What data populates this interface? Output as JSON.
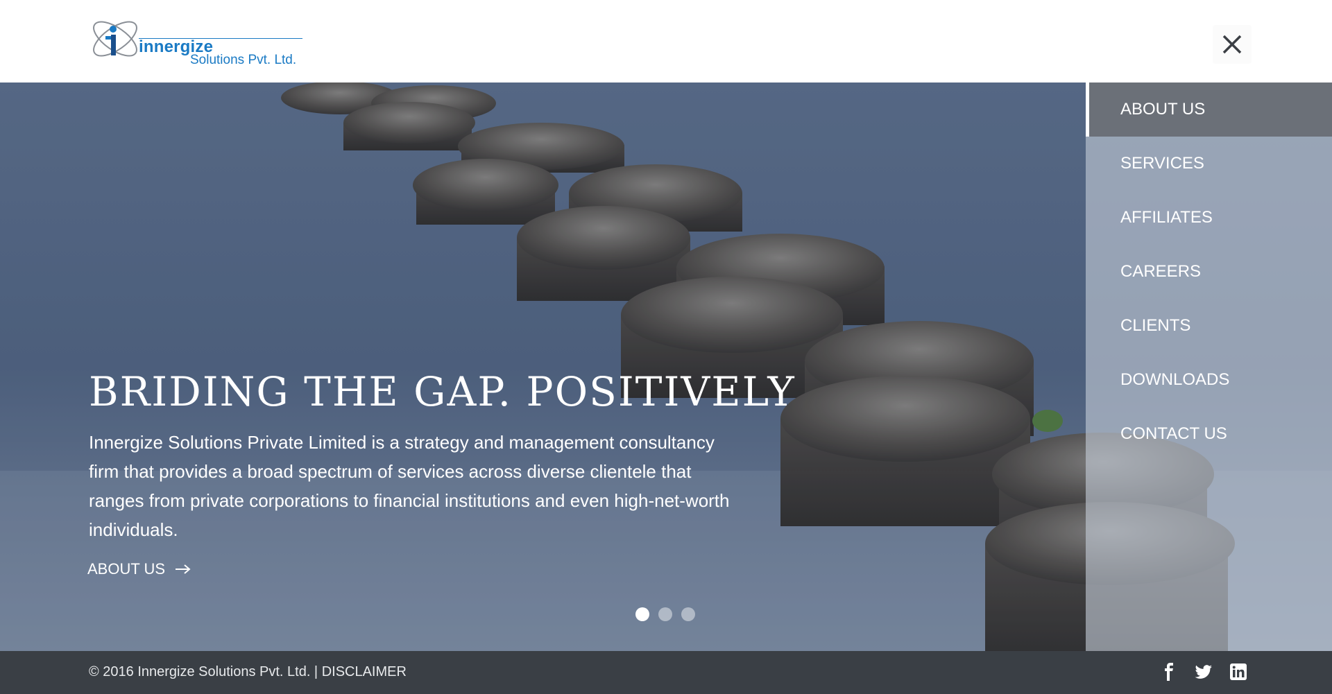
{
  "header": {
    "logo_brand": "innergize",
    "logo_sub": "Solutions Pvt. Ltd.",
    "close_icon": "close-icon"
  },
  "hero": {
    "title": "BRIDING THE GAP. POSITIVELY",
    "text": "Innergize Solutions Private Limited is a strategy and management consultancy firm that provides a broad spectrum of services across diverse clientele that ranges from private corporations to financial institutions and even high-net-worth individuals.",
    "cta_label": "ABOUT US",
    "cta_icon": "arrow-right-icon",
    "slides": {
      "count": 3,
      "active": 1
    }
  },
  "menu": {
    "items": [
      {
        "label": "ABOUT US",
        "active": true
      },
      {
        "label": "SERVICES",
        "active": false
      },
      {
        "label": "AFFILIATES",
        "active": false
      },
      {
        "label": "CAREERS",
        "active": false
      },
      {
        "label": "CLIENTS",
        "active": false
      },
      {
        "label": "DOWNLOADS",
        "active": false
      },
      {
        "label": "CONTACT US",
        "active": false
      }
    ]
  },
  "footer": {
    "copyright": "© 2016 Innergize Solutions Pvt. Ltd. | ",
    "disclaimer": "DISCLAIMER",
    "socials": [
      "facebook-icon",
      "twitter-icon",
      "linkedin-icon"
    ]
  },
  "colors": {
    "brand": "#1a7ac4",
    "footer_bg": "#3a3f45",
    "menu_active_bg": "#6b7078"
  }
}
